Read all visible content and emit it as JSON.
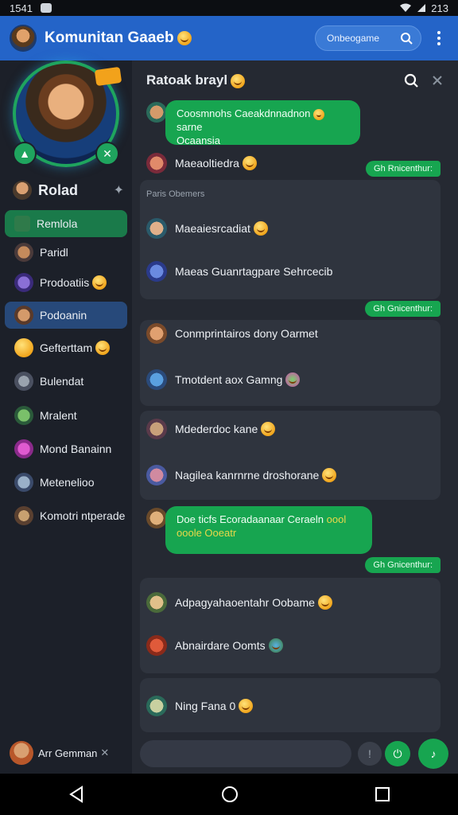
{
  "status": {
    "time": "1541",
    "battery": "213"
  },
  "app": {
    "title": "Komunitan Gaaeb",
    "search_placeholder": "Onbeogame"
  },
  "colors": {
    "appbar": "#2464c8",
    "accent_green": "#17a550",
    "sidebar": "#1c2029",
    "chat_bg": "#252932"
  },
  "sidebar": {
    "profile_name": "Rolad",
    "items": [
      {
        "label": "Remlola",
        "state": "active-green"
      },
      {
        "label": "Paridl"
      },
      {
        "label": "Prodoatiis"
      },
      {
        "label": "Podoanin",
        "state": "active-blue"
      },
      {
        "label": "Gefterttam"
      },
      {
        "label": "Bulendat"
      },
      {
        "label": "Mralent"
      },
      {
        "label": "Mond Banainn"
      },
      {
        "label": "Metenelioo"
      },
      {
        "label": "Komotri ntperade"
      }
    ],
    "footer_user": "Arr Gemman"
  },
  "chat": {
    "title": "Ratoak brayl",
    "section_label": "Paris Obemers",
    "messages": [
      {
        "text": "Coosmnohs Caeakdnnadnon",
        "extra": "sarne",
        "line2": "Ocaansia"
      },
      {
        "text": "Maeaoltiedra"
      },
      {
        "tag": "Gh Rnicenthur:"
      },
      {
        "text": "Maeaiesrcadiat"
      },
      {
        "text": "Maeas Guanrtagpare Sehrcecib"
      },
      {
        "tag": "Gh Gnicenthur:"
      },
      {
        "text": "Conmprintairos dony Oarmet"
      },
      {
        "text": "Tmotdent aox Gamng"
      },
      {
        "text": "Mdederdoc kane"
      },
      {
        "text": "Nagilea kanrnrne droshorane"
      },
      {
        "text": "Doe ticfs Ecoradaanaar Ceraeln",
        "extra": "oool",
        "line2": "ooole Ooeatr"
      },
      {
        "tag": "Gh Gnicenthur:"
      },
      {
        "text": "Adpagyahaoentahr Oobame"
      },
      {
        "text": "Abnairdare Oomts"
      },
      {
        "text": "Ning Fana 0"
      }
    ]
  }
}
